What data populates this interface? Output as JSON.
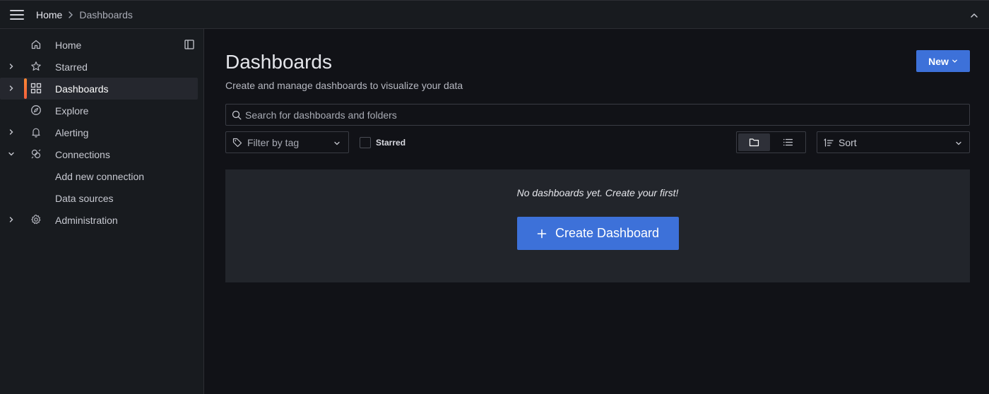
{
  "topbar": {
    "breadcrumb": [
      {
        "label": "Home"
      },
      {
        "label": "Dashboards"
      }
    ]
  },
  "sidebar": {
    "items": [
      {
        "label": "Home",
        "icon": "home-icon",
        "expandable": false,
        "active": false
      },
      {
        "label": "Starred",
        "icon": "star-icon",
        "expandable": true,
        "active": false
      },
      {
        "label": "Dashboards",
        "icon": "apps-icon",
        "expandable": true,
        "active": true
      },
      {
        "label": "Explore",
        "icon": "compass-icon",
        "expandable": false,
        "active": false
      },
      {
        "label": "Alerting",
        "icon": "bell-icon",
        "expandable": true,
        "active": false
      },
      {
        "label": "Connections",
        "icon": "connections-icon",
        "expandable": true,
        "expanded": true,
        "active": false
      },
      {
        "label": "Add new connection",
        "sub": true
      },
      {
        "label": "Data sources",
        "sub": true
      },
      {
        "label": "Administration",
        "icon": "cog-icon",
        "expandable": true,
        "active": false
      }
    ]
  },
  "main": {
    "title": "Dashboards",
    "subtitle": "Create and manage dashboards to visualize your data",
    "new_button": "New",
    "search_placeholder": "Search for dashboards and folders",
    "filter_by_tag": "Filter by tag",
    "starred_label": "Starred",
    "sort_label": "Sort",
    "empty_message": "No dashboards yet. Create your first!",
    "create_button": "Create Dashboard"
  },
  "colors": {
    "primary": "#3d71d9",
    "active_bar": "#ff8833",
    "background": "#111217",
    "panel": "#181b1f"
  }
}
